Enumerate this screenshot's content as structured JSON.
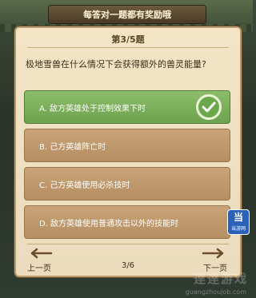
{
  "banner": "每答对一题都有奖励哦",
  "quiz": {
    "question_number": "第3/5题",
    "question": "极地雪兽在什么情况下会获得额外的兽灵能量?",
    "options": [
      {
        "label": "A. 敌方英雄处于控制效果下时",
        "selected": true
      },
      {
        "label": "B. 己方英雄阵亡时",
        "selected": false
      },
      {
        "label": "C. 己方英雄使用必杀技时",
        "selected": false
      },
      {
        "label": "D. 敌方英雄使用普通攻击以外的技能时",
        "selected": false
      }
    ]
  },
  "nav": {
    "prev_label": "上一页",
    "next_label": "下一页",
    "page": "3/6"
  },
  "badge": {
    "main": "当",
    "sub": "当游网"
  },
  "watermark": {
    "brand": "逹逹游戏",
    "url": "guangzhoujob.com"
  },
  "colors": {
    "selected": "#6da24e",
    "option": "#b58e62",
    "panel": "#f3e4c6"
  },
  "icons": [
    "check-mark-icon",
    "arrow-left-icon",
    "arrow-right-icon"
  ]
}
